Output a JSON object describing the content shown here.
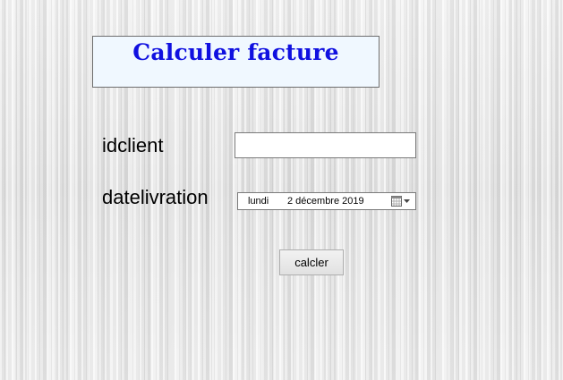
{
  "header": {
    "title": "Calculer facture"
  },
  "form": {
    "idclient_label": "idclient",
    "idclient_value": "",
    "datelivration_label": "datelivration",
    "date_day": "lundi",
    "date_value": "2 décembre 2019"
  },
  "actions": {
    "calculate_label": "calcler"
  },
  "colors": {
    "title": "#1010e0",
    "title_background": "#f0f8ff"
  },
  "icons": {
    "date_dropdown": "calendar-dropdown-icon"
  }
}
